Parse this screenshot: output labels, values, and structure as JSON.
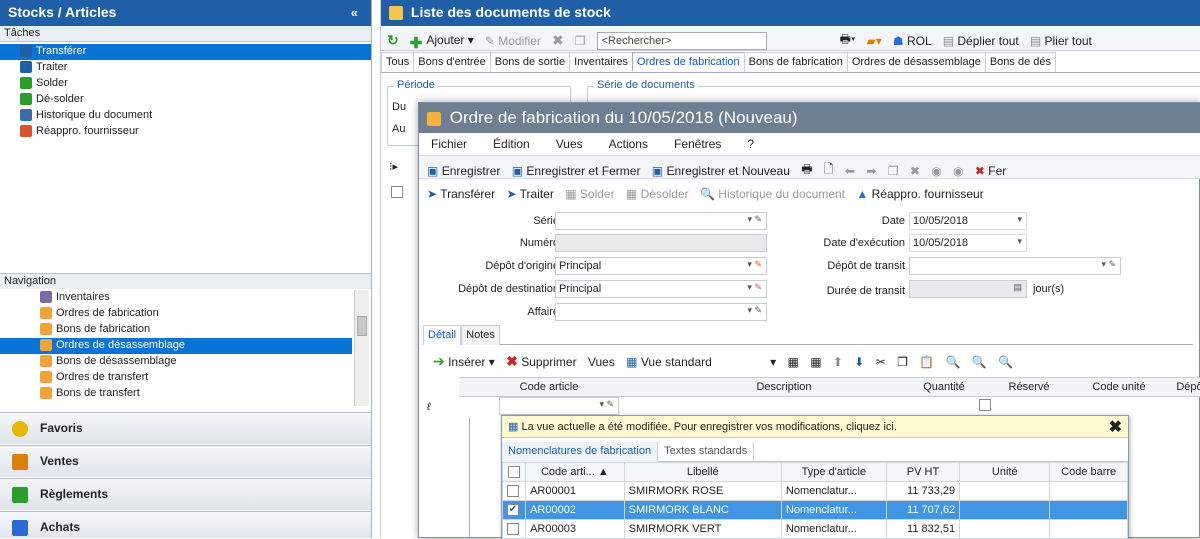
{
  "left": {
    "title": "Stocks / Articles",
    "collapse": "«",
    "tasks_title": "Tâches",
    "tasks": [
      {
        "label": "Transférer",
        "icon": "transfer-icon",
        "selected": true
      },
      {
        "label": "Traiter",
        "icon": "process-icon"
      },
      {
        "label": "Solder",
        "icon": "settle-icon"
      },
      {
        "label": "Dé-solder",
        "icon": "unsettle-icon"
      },
      {
        "label": "Historique du document",
        "icon": "history-icon"
      },
      {
        "label": "Réappro. fournisseur",
        "icon": "restock-icon"
      }
    ],
    "nav_title": "Navigation",
    "nav_items": [
      {
        "label": "Inventaires",
        "icon": "inventory-icon"
      },
      {
        "label": "Ordres de fabrication",
        "icon": "manufacturing-order-icon"
      },
      {
        "label": "Bons de fabrication",
        "icon": "manufacturing-voucher-icon"
      },
      {
        "label": "Ordres de désassemblage",
        "icon": "disassembly-order-icon",
        "selected": true
      },
      {
        "label": "Bons de désassemblage",
        "icon": "disassembly-voucher-icon"
      },
      {
        "label": "Ordres de transfert",
        "icon": "transfer-order-icon"
      },
      {
        "label": "Bons de transfert",
        "icon": "transfer-voucher-icon"
      }
    ],
    "sections": [
      {
        "label": "Favoris",
        "icon": "star-icon"
      },
      {
        "label": "Ventes",
        "icon": "sales-icon"
      },
      {
        "label": "Règlements",
        "icon": "payments-icon"
      },
      {
        "label": "Achats",
        "icon": "purchases-icon"
      }
    ]
  },
  "right": {
    "title": "Liste des documents de stock",
    "toolbar": {
      "add": "Ajouter",
      "modify": "Modifier",
      "search_placeholder": "<Rechercher>",
      "rol": "ROL",
      "expand": "Déplier tout",
      "collapse": "Plier tout"
    },
    "tabs": [
      "Tous",
      "Bons d'entrée",
      "Bons de sortie",
      "Inventaires",
      "Ordres de fabrication",
      "Bons de fabrication",
      "Ordres de désassemblage",
      "Bons de dés"
    ],
    "active_tab": "Ordres de fabrication",
    "periode": {
      "legend": "Période",
      "du": "Du",
      "au": "Au"
    },
    "serie_legend": "Série de documents"
  },
  "modal": {
    "title": "Ordre de fabrication du 10/05/2018 (Nouveau)",
    "menu": [
      "Fichier",
      "Édition",
      "Vues",
      "Actions",
      "Fenêtres",
      "?"
    ],
    "toolbar": {
      "save": "Enregistrer",
      "save_close": "Enregistrer et Fermer",
      "save_new": "Enregistrer et Nouveau",
      "close": "Fer"
    },
    "actions": {
      "transfer": "Transférer",
      "process": "Traiter",
      "settle": "Solder",
      "unsettle": "Désolder",
      "history": "Historique du document",
      "restock": "Réappro. fournisseur"
    },
    "form": {
      "serie_label": "Série",
      "serie_value": "",
      "numero_label": "Numéro",
      "numero_value": "",
      "depot_origine_label": "Dépôt d'origine",
      "depot_origine_value": "Principal",
      "depot_destination_label": "Dépôt de destination",
      "depot_destination_value": "Principal",
      "affaire_label": "Affaire",
      "affaire_value": "",
      "date_label": "Date",
      "date_value": "10/05/2018",
      "date_exec_label": "Date d'exécution",
      "date_exec_value": "10/05/2018",
      "depot_transit_label": "Dépôt de transit",
      "depot_transit_value": "",
      "duree_transit_label": "Durée de transit",
      "duree_transit_unit": "jour(s)"
    },
    "detail_tabs": [
      "Détail",
      "Notes"
    ],
    "detail_toolbar": {
      "insert": "Insérer",
      "delete": "Supprimer",
      "views": "Vues",
      "view_name": "Vue standard"
    },
    "grid_columns": [
      "Code article",
      "Description",
      "Quantité",
      "Réservé",
      "Code unité",
      "Dépôt"
    ],
    "popup": {
      "note": "La vue actuelle a été modifiée. Pour enregistrer vos modifications, cliquez ici.",
      "tabs": [
        "Nomenclatures de fabrication",
        "Textes standards"
      ],
      "columns": [
        "Code arti... ▲",
        "Libellé",
        "Type d'article",
        "PV HT",
        "Unité",
        "Code barre"
      ],
      "rows": [
        {
          "checked": false,
          "code": "AR00001",
          "libelle": "SMIRMORK ROSE",
          "type": "Nomenclatur...",
          "pv": "11 733,29",
          "unite": "",
          "barre": ""
        },
        {
          "checked": true,
          "code": "AR00002",
          "libelle": "SMIRMORK BLANC",
          "type": "Nomenclatur...",
          "pv": "11 707,62",
          "unite": "",
          "barre": "",
          "selected": true
        },
        {
          "checked": false,
          "code": "AR00003",
          "libelle": "SMIRMORK VERT",
          "type": "Nomenclatur...",
          "pv": "11 832,51",
          "unite": "",
          "barre": ""
        }
      ]
    }
  }
}
